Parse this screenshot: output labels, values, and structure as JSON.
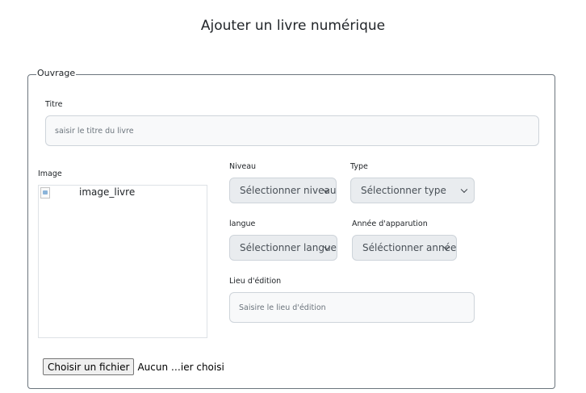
{
  "page": {
    "title": "Ajouter un livre numérique"
  },
  "form": {
    "legend": "Ouvrage",
    "titre": {
      "label": "Titre",
      "placeholder": "saisir le titre du livre"
    },
    "image": {
      "label": "Image",
      "alt": "image_livre"
    },
    "niveau": {
      "label": "Niveau",
      "value": "Sélectionner niveau"
    },
    "type": {
      "label": "Type",
      "value": "Sélectionner type"
    },
    "langue": {
      "label": "langue",
      "value": "Sélectionner langue"
    },
    "annee": {
      "label": "Année d'apparution",
      "value": "Séléctionner année"
    },
    "lieu": {
      "label": "Lieu d'édition",
      "placeholder": "Saisire le lieu d'édition"
    },
    "file": {
      "button_label": "Choisir un fichier",
      "status": "Aucun …ier choisi"
    }
  },
  "icons": {
    "select_arrow": "chevron-down-icon",
    "broken_image": "broken-image-icon"
  }
}
